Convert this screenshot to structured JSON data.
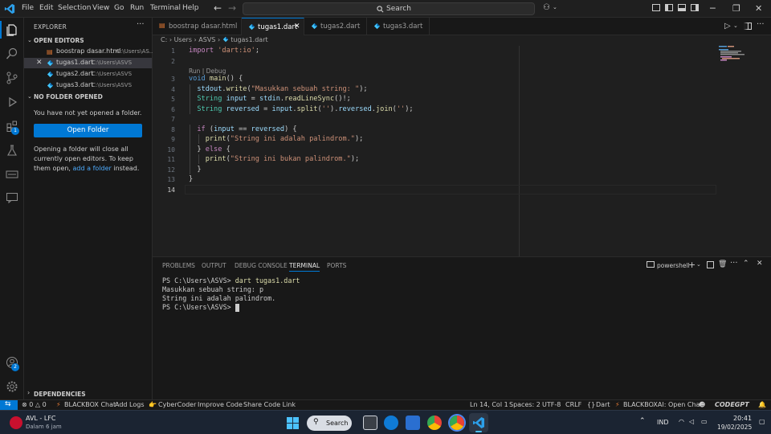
{
  "menu": [
    "File",
    "Edit",
    "Selection",
    "View",
    "Go",
    "Run",
    "Terminal",
    "Help"
  ],
  "search": {
    "label": "Search"
  },
  "sidebar": {
    "title": "EXPLORER",
    "open_editors_label": "OPEN EDITORS",
    "open_editors": [
      {
        "name": "boostrap dasar.html",
        "path": "C:\\Users\\AS...",
        "icon": "html-file-icon",
        "active": false
      },
      {
        "name": "tugas1.dart",
        "path": "C:\\Users\\ASVS",
        "icon": "dart-file-icon",
        "active": true
      },
      {
        "name": "tugas2.dart",
        "path": "C:\\Users\\ASVS",
        "icon": "dart-file-icon",
        "active": false
      },
      {
        "name": "tugas3.dart",
        "path": "C:\\Users\\ASVS",
        "icon": "dart-file-icon",
        "active": false
      }
    ],
    "no_folder_label": "NO FOLDER OPENED",
    "no_folder_text": "You have not yet opened a folder.",
    "open_folder_button": "Open Folder",
    "info_text_1": "Opening a folder will close all currently open editors. To keep them open, ",
    "info_link": "add a folder",
    "info_text_2": " instead.",
    "dependencies_label": "DEPENDENCIES"
  },
  "activity_badges": {
    "extensions": "1",
    "accounts": "2"
  },
  "tabs": [
    {
      "label": "boostrap dasar.html",
      "active": false
    },
    {
      "label": "tugas1.dart",
      "active": true
    },
    {
      "label": "tugas2.dart",
      "active": false
    },
    {
      "label": "tugas3.dart",
      "active": false
    }
  ],
  "breadcrumb": {
    "drive": "C:",
    "users": "Users",
    "user": "ASVS",
    "file": "tugas1.dart"
  },
  "editor": {
    "codelens": "Run | Debug",
    "line_numbers": [
      "1",
      "2",
      "3",
      "4",
      "5",
      "6",
      "7",
      "8",
      "9",
      "10",
      "11",
      "12",
      "13",
      "14"
    ],
    "lines": [
      "import 'dart:io';",
      "",
      "void main() {",
      "  stdout.write(\"Masukkan sebuah string: \");",
      "  String input = stdin.readLineSync()!;",
      "  String reversed = input.split('').reversed.join('');",
      "",
      "  if (input == reversed) {",
      "    print(\"String ini adalah palindrom.\");",
      "  } else {",
      "    print(\"String ini bukan palindrom.\");",
      "  }",
      "}",
      ""
    ]
  },
  "panel": {
    "tabs": [
      "PROBLEMS",
      "OUTPUT",
      "DEBUG CONSOLE",
      "TERMINAL",
      "PORTS"
    ],
    "active_tab": "TERMINAL",
    "shell": "powershell",
    "terminal_lines": [
      {
        "prompt": "PS C:\\Users\\ASVS> ",
        "cmd": "dart tugas1.dart"
      },
      {
        "prompt": "Masukkan sebuah string: p",
        "cmd": ""
      },
      {
        "prompt": "String ini adalah palindrom.",
        "cmd": ""
      },
      {
        "prompt": "PS C:\\Users\\ASVS> ",
        "cmd": ""
      }
    ]
  },
  "statusbar": {
    "errors": "0",
    "warnings": "0",
    "blackbox_chat": "BLACKBOX Chat",
    "add_logs": "Add Logs",
    "cybercoder": "CyberCoder",
    "improve_code": "Improve Code",
    "share_code": "Share Code Link",
    "position": "Ln 14, Col 1",
    "spaces": "Spaces: 2",
    "encoding": "UTF-8",
    "eol": "CRLF",
    "language": "Dart",
    "blackboxai": "BLACKBOXAI: Open Chat",
    "codegpt": "CODEGPT"
  },
  "taskbar": {
    "widget_title": "AVL - LFC",
    "widget_sub": "Dalam 6 jam",
    "search_label": "Search",
    "lang": "IND",
    "time": "20:41",
    "date": "19/02/2025"
  },
  "colors": {
    "accent": "#0078d4",
    "background": "#1f1f1f",
    "sidebar": "#181818"
  }
}
